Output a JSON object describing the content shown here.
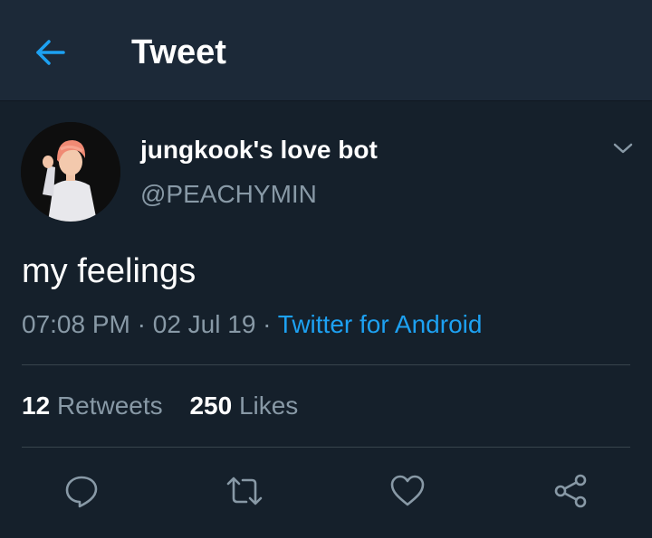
{
  "header": {
    "title": "Tweet",
    "back_icon": "arrow-left-icon",
    "accent_color": "#1da1f2"
  },
  "tweet": {
    "author": {
      "display_name": "jungkook's love bot",
      "handle": "@PEACHYMIN",
      "avatar_alt": "profile photo"
    },
    "text": "my feelings",
    "time": "07:08 PM",
    "date": "02 Jul 19",
    "separator": "·",
    "source": "Twitter for Android",
    "retweets_count": "12",
    "retweets_label": "Retweets",
    "likes_count": "250",
    "likes_label": "Likes"
  },
  "actions": [
    {
      "icon": "reply-icon"
    },
    {
      "icon": "retweet-icon"
    },
    {
      "icon": "like-icon"
    },
    {
      "icon": "share-icon"
    }
  ],
  "colors": {
    "background": "#15202b",
    "header_background": "#1c2938",
    "secondary_text": "#8899a6",
    "divider": "#38444d",
    "link": "#1da1f2"
  }
}
